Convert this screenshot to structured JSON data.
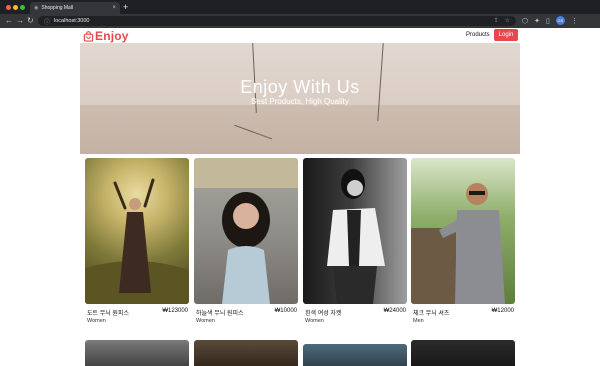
{
  "browser": {
    "tab_title": "Shopping Mall",
    "url": "localhost:3000",
    "profile_initials": "GS"
  },
  "header": {
    "brand": "Enjoy",
    "products_link": "Products",
    "login_button": "Login"
  },
  "hero": {
    "title": "Enjoy With Us",
    "subtitle": "Best Products, High Quality"
  },
  "products": [
    {
      "name": "도트 무늬 원피스",
      "price": "₩123000",
      "category": "Women"
    },
    {
      "name": "하늘색 무늬 원피스",
      "price": "₩10000",
      "category": "Women"
    },
    {
      "name": "흰색 여성 자켓",
      "price": "₩24000",
      "category": "Women"
    },
    {
      "name": "체크 무늬 셔츠",
      "price": "₩12000",
      "category": "Men"
    }
  ],
  "colors": {
    "accent": "#e5484d",
    "chrome_dark": "#1f2023"
  }
}
